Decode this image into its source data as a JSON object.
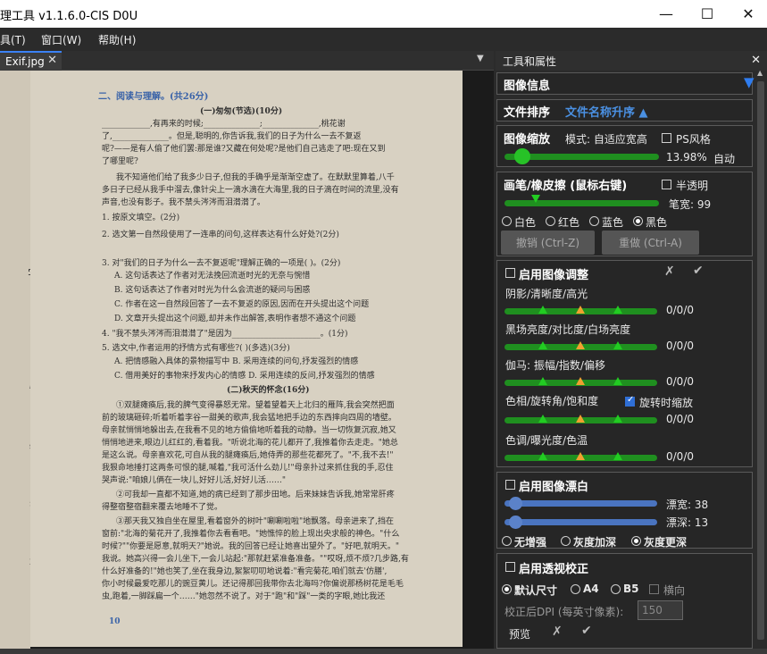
{
  "window": {
    "title": "理工具 v1.1.6.0-CIS D0U",
    "minimize": "—",
    "maximize": "☐",
    "close": "✕"
  },
  "menu": [
    "具(T)",
    "窗口(W)",
    "帮助(H)"
  ],
  "tab": {
    "label": "Exif.jpg",
    "close": "✕",
    "dropdown": "▼"
  },
  "panel": {
    "title": "工具和属性",
    "close": "✕",
    "image_info": {
      "label": "图像信息",
      "toggle": "▼"
    },
    "sort": {
      "label": "文件排序",
      "value": "文件名称升序 ▲"
    },
    "zoom": {
      "label": "图像缩放",
      "mode_label": "模式: 自适应宽高",
      "ps_style": "PS风格",
      "percent": "13.98%",
      "auto": "自动",
      "slider_level": 0.07
    },
    "brush": {
      "label": "画笔/橡皮擦 (鼠标右键)",
      "translucent": "半透明",
      "width_label": "笔宽: 99",
      "slider_level": 0.2,
      "colors": [
        "白色",
        "红色",
        "蓝色",
        "黑色"
      ],
      "selected_color": "黑色",
      "undo": "撤销 (Ctrl-Z)",
      "redo": "重做 (Ctrl-A)"
    },
    "adjust": {
      "enable": "启用图像调整",
      "cancel_icon": "✗",
      "ok_icon": "✔",
      "rows": [
        {
          "label": "阴影/清晰度/高光",
          "value": "0/0/0"
        },
        {
          "label": "黑场亮度/对比度/白场亮度",
          "value": "0/0/0"
        },
        {
          "label": "伽马: 振幅/指数/偏移",
          "value": "0/0/0"
        },
        {
          "label": "色相/旋转角/饱和度",
          "value": "0/0/0"
        },
        {
          "label": "色调/曝光度/色温",
          "value": "0/0/0"
        }
      ],
      "rotate_zoom": "旋转时缩放"
    },
    "whiten": {
      "enable": "启用图像漂白",
      "width_label": "漂宽: 38",
      "depth_label": "漂深: 13",
      "width_level": 0.03,
      "depth_level": 0.03,
      "modes": [
        "无增强",
        "灰度加深",
        "灰度更深"
      ],
      "selected_mode": "灰度更深"
    },
    "perspective": {
      "enable": "启用透视校正",
      "sizes": [
        "默认尺寸",
        "A4",
        "B5"
      ],
      "selected_size": "默认尺寸",
      "landscape": "横向",
      "dpi_label": "校正后DPI (每英寸像素):",
      "dpi_value": "150",
      "preview": "预览",
      "cancel_icon": "✗",
      "ok_icon": "✔"
    }
  },
  "document": {
    "side_chars": [
      "字",
      "情",
      "物",
      "答",
      "题"
    ],
    "page_number": "10",
    "lines": [
      "二、阅读与理解。(共26分)",
      "(一)匆匆(节选)(10分)",
      "____________,有再来的时候;______________;______________,桃花谢",
      "了,______________。但是,聪明的,你告诉我,我们的日子为什么一去不复返",
      "呢?——是有人偷了他们罢:那是谁?又藏在何处呢?是他们自己逃走了吧:现在又到",
      "了哪里呢?",
      "我不知道他们给了我多少日子,但我的手确乎是渐渐空虚了。在默默里算着,八千",
      "多日子已经从我手中溜去,像针尖上一滴水滴在大海里,我的日子滴在时间的流里,没有",
      "声音,也没有影子。我不禁头涔涔而泪潸潸了。",
      "1. 按原文填空。(2分)",
      "2. 选文第一自然段使用了一连串的问句,这样表达有什么好处?(2分)",
      "3. 对\"我们的日子为什么一去不复返呢\"理解正确的一项是(    )。(2分)",
      "A. 这句话表达了作者对无法挽回流逝时光的无奈与惋惜",
      "B. 这句话表达了作者对时光为什么会流逝的疑问与困惑",
      "C. 作者在这一自然段回答了一去不复返的原因,因而在开头提出这个问题",
      "D. 文章开头提出这个问题,却并未作出解答,表明作者想不通这个问题",
      "4. \"我不禁头涔涔而泪潸潸了\"是因为______________________。(1分)",
      "5. 选文中,作者运用的抒情方式有哪些?(      )(多选)(3分)",
      "A. 把情感融入具体的景物描写中          B. 采用连续的问句,抒发强烈的情感",
      "C. 借用美好的事物来抒发内心的情感      D. 采用连续的反问,抒发强烈的情感",
      "(二)秋天的怀念(16分)",
      "①双腿瘫痪后,我的脾气变得暴怒无常。望着望着天上北归的雁阵,我会突然把面",
      "前的玻璃砸碎;听着听着李谷一甜美的歌声,我会猛地把手边的东西摔向四周的墙壁。",
      "母亲就悄悄地躲出去,在我看不见的地方偷偷地听着我的动静。当一切恢复沉寂,她又",
      "悄悄地进来,眼边儿红红的,看着我。\"听说北海的花儿都开了,我推着你去走走。\"她总",
      "是这么说。母亲喜欢花,可自从我的腿瘫痪后,她侍弄的那些花都死了。\"不,我不去!\"",
      "我狠命地捶打这两条可恨的腿,喊着,\"我可活什么劲儿!\"母亲扑过来抓住我的手,忍住",
      "哭声说:\"咱娘儿俩在一块儿,好好儿活,好好儿活……\"",
      "②可我却一直都不知道,她的病已经到了那步田地。后来妹妹告诉我,她常常肝疼",
      "得整宿整宿翻来覆去地睡不了觉。",
      "③那天我又独自坐在屋里,看着窗外的树叶\"唰唰啦啦\"地飘落。母亲进来了,挡在",
      "窗前:\"北海的菊花开了,我推着你去看看吧。\"她憔悴的脸上现出央求般的神色。\"什么",
      "时候?\"\"你要是愿意,就明天?\"她说。我的回答已经让她喜出望外了。\"好吧,就明天。\"",
      "我说。她高兴得一会儿坐下,一会儿站起:\"那就赶紧准备准备。\"\"哎呀,烦不烦?几步路,有",
      "什么好准备的!\"她也笑了,坐在我身边,絮絮叨叨地说着:\"看完菊花,咱们就去'仿膳',",
      "你小时候最爱吃那儿的豌豆黄儿。还记得那回我带你去北海吗?你偏说那杨树花是毛毛",
      "虫,跑着,一脚踩扁一个……\"她忽然不说了。对于\"跑\"和\"踩\"一类的字眼,她比我还"
    ]
  }
}
